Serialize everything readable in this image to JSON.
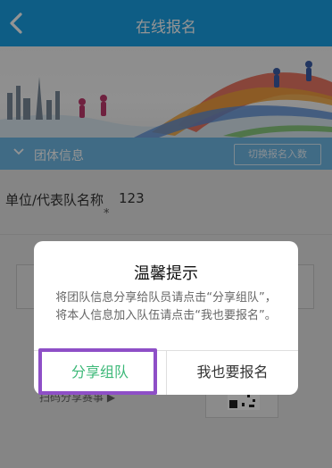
{
  "header": {
    "title": "在线报名"
  },
  "section": {
    "title": "团体信息",
    "switch_label": "切换报名入数"
  },
  "form": {
    "field_label": "单位/代表队名称",
    "field_value": "123",
    "required_mark": "*",
    "scan_text": "扫码分享赛事 ▶"
  },
  "dialog": {
    "title": "温馨提示",
    "message": "将团队信息分享给队员请点击“分享组队”，将本人信息加入队伍请点击“我也要报名”。",
    "share_button": "分享组队",
    "join_button": "我也要报名"
  },
  "colors": {
    "header": "#19a0e6",
    "section": "#6fb9e6",
    "share_button_text": "#3cb878",
    "highlight": "#8e4fc7"
  }
}
